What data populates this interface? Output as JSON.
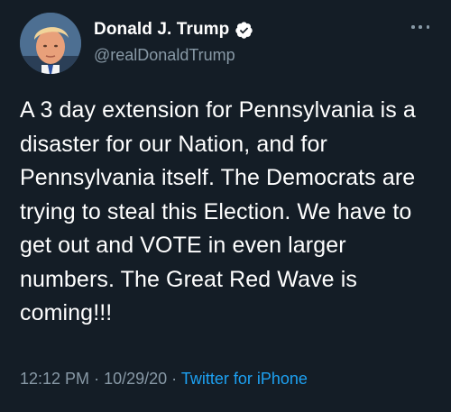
{
  "author": {
    "display_name": "Donald J. Trump",
    "handle": "@realDonaldTrump",
    "verified": true,
    "verified_icon": "verified-badge-icon",
    "avatar_icon": "profile-photo"
  },
  "menu": {
    "icon": "more-options-icon"
  },
  "tweet": {
    "lines": [
      "A 3 day extension for Pennsylvania is a",
      "disaster for our Nation, and for",
      "Pennsylvania itself. The Democrats are",
      "trying to steal this Election. We have to",
      "get out and VOTE in even larger",
      "numbers. The Great Red Wave is",
      "coming!!!"
    ]
  },
  "meta": {
    "time": "12:12 PM",
    "separator": "·",
    "date": "10/29/20",
    "source": "Twitter for iPhone"
  },
  "colors": {
    "background": "#141d26",
    "text": "#ffffff",
    "secondary": "#8899a6",
    "link": "#1da1f2"
  }
}
